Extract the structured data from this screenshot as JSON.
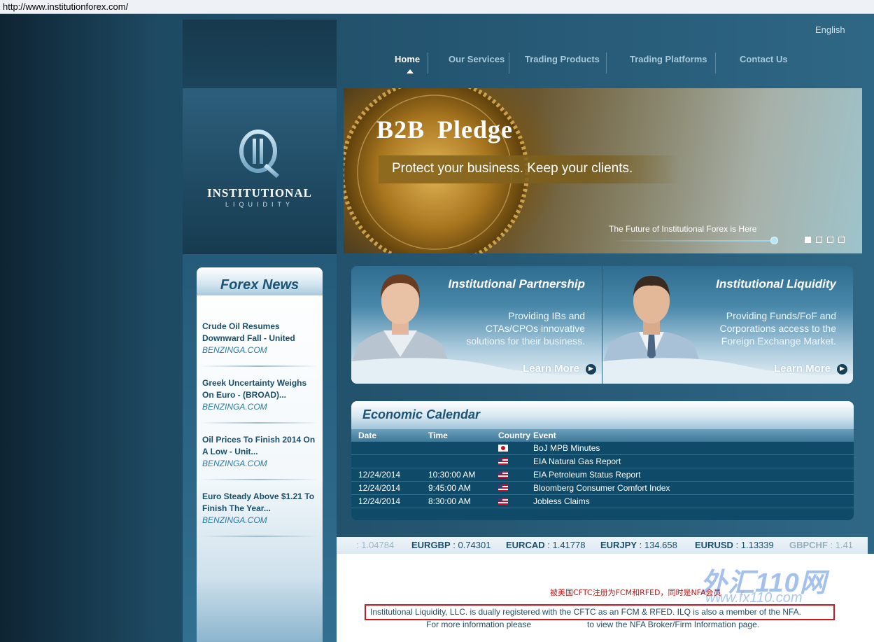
{
  "browser": {
    "url": "http://www.institutionforex.com/"
  },
  "header": {
    "language": "English",
    "nav": [
      {
        "label": "Home",
        "active": true
      },
      {
        "label": "Our Services"
      },
      {
        "label": "Trading Products"
      },
      {
        "label": "Trading Platforms"
      },
      {
        "label": "Contact Us"
      }
    ]
  },
  "logo": {
    "name": "INSTITUTIONAL",
    "sub": "LIQUIDITY"
  },
  "banner": {
    "title": "B2B Pledge",
    "tagline": "Protect your business.  Keep your clients.",
    "footer": "The Future of Institutional Forex is Here",
    "slides": 4,
    "active_slide": 1
  },
  "news": {
    "title": "Forex News",
    "items": [
      {
        "title": "Crude Oil Resumes Downward Fall - United",
        "source": "BENZINGA.COM"
      },
      {
        "title": "Greek Uncertainty Weighs On Euro - (BROAD)...",
        "source": "BENZINGA.COM"
      },
      {
        "title": "Oil Prices To Finish 2014 On A Low - Unit...",
        "source": "BENZINGA.COM"
      },
      {
        "title": "Euro Steady Above $1.21 To Finish The Year...",
        "source": "BENZINGA.COM"
      }
    ]
  },
  "panels": [
    {
      "title": "Institutional Partnership",
      "desc": [
        "Providing IBs and",
        "CTAs/CPOs innovative",
        "solutions for their business."
      ],
      "more": "Learn More"
    },
    {
      "title": "Institutional Liquidity",
      "desc": [
        "Providing Funds/FoF and",
        "Corporations access to the",
        "Foreign Exchange Market."
      ],
      "more": "Learn More"
    }
  ],
  "calendar": {
    "title": "Economic Calendar",
    "columns": [
      "Date",
      "Time",
      "Country",
      "Event"
    ],
    "rows": [
      {
        "date": "",
        "time": "",
        "country": "japan",
        "event": "BoJ MPB Minutes"
      },
      {
        "date": "",
        "time": "",
        "country": "usa",
        "event": "EIA Natural Gas Report"
      },
      {
        "date": "12/24/2014",
        "time": "10:30:00 AM",
        "country": "usa",
        "event": "EIA Petroleum Status Report"
      },
      {
        "date": "12/24/2014",
        "time": "9:45:00 AM",
        "country": "usa",
        "event": "Bloomberg Consumer Comfort Index"
      },
      {
        "date": "12/24/2014",
        "time": "8:30:00 AM",
        "country": "usa",
        "event": "Jobless Claims"
      }
    ]
  },
  "ticker": [
    {
      "pair": "",
      "value": ": 1.04784"
    },
    {
      "pair": "EURGBP",
      "value": ": 0.74301"
    },
    {
      "pair": "EURCAD",
      "value": ": 1.41778"
    },
    {
      "pair": "EURJPY",
      "value": ": 134.658"
    },
    {
      "pair": "EURUSD",
      "value": ": 1.13339"
    },
    {
      "pair": "GBPCHF",
      "value": ": 1.41"
    }
  ],
  "footer": {
    "note_cn": "被美国CFTC注册为FCM和RFED，同时是NFA会员",
    "registration": "Institutional Liquidity, LLC. is dually registered with the CFTC as an FCM & RFED. ILQ is also a member of the NFA.",
    "more_info_a": "For more information please",
    "more_info_b": "to view the NFA Broker/Firm Information page."
  },
  "watermark": {
    "line1": "外汇110网",
    "line2": "www.fx110.com"
  },
  "colors": {
    "accent": "#1a5576",
    "nav_text": "#a7c9dc",
    "highlight": "#d3131e"
  }
}
